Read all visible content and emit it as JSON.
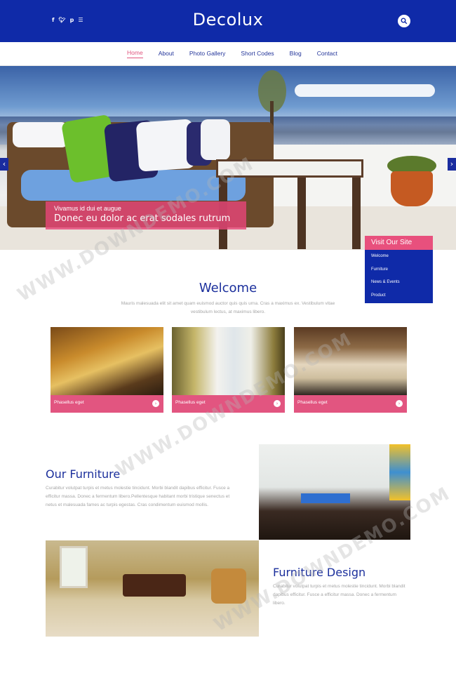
{
  "header": {
    "logo": "Decolux",
    "social": [
      "f",
      "t",
      "p",
      "rss"
    ]
  },
  "nav": {
    "items": [
      {
        "label": "Home",
        "active": true
      },
      {
        "label": "About",
        "active": false
      },
      {
        "label": "Photo Gallery",
        "active": false
      },
      {
        "label": "Short Codes",
        "active": false
      },
      {
        "label": "Blog",
        "active": false
      },
      {
        "label": "Contact",
        "active": false
      }
    ]
  },
  "hero": {
    "caption_small": "Vivamus id dui et augue",
    "caption_big": "Donec eu dolor ac erat sodales rutrum"
  },
  "visit_box": {
    "title": "Visit Our Site",
    "items": [
      "Welcome",
      "Furniture",
      "News & Events",
      "Product"
    ]
  },
  "welcome": {
    "title": "Welcome",
    "text": "Mauris malesuada elit sit amet quam euismod auctor quis quis urna. Cras a maximus ex. Vestibulum vitae vestibulum lectus, at maximus libero."
  },
  "cards": [
    {
      "label": "Phasellus eget"
    },
    {
      "label": "Phasellus eget"
    },
    {
      "label": "Phasellus eget"
    }
  ],
  "furniture": {
    "title": "Our Furniture",
    "text": "Curabitur volutpat turpis et metus molestie tincidunt. Morbi blandit dapibus efficitur. Fusce a efficitur massa. Donec a fermentum libero.Pellentesque habitant morbi tristique senectus et netus et malesuada fames ac turpis egestas. Cras condimentum euismod mollis."
  },
  "design": {
    "title": "Furniture Design",
    "text": "Curabitur volutpat turpis et metus molestie tincidunt. Morbi blandit dapibus efficitur. Fusce a efficitur massa. Donec a fermentum libero."
  },
  "watermark": "WWW.DOWNDEMO.COM",
  "colors": {
    "brand_blue": "#0f2aa8",
    "accent_pink": "#e25580"
  }
}
